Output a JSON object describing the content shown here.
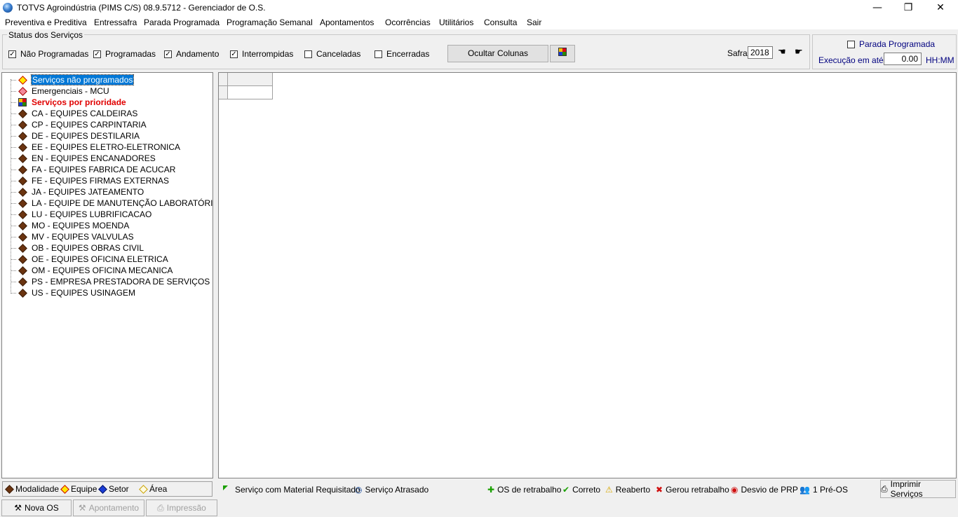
{
  "window": {
    "title": "TOTVS Agroindústria (PIMS C/S) 08.9.5712 - Gerenciador de O.S.",
    "minimize": "—",
    "restore": "❐",
    "close": "✕"
  },
  "menu": [
    "Preventiva e Preditiva",
    "Entressafra",
    "Parada Programada",
    "Programação Semanal",
    "Apontamentos",
    "Ocorrências",
    "Utilitários",
    "Consulta",
    "Sair"
  ],
  "status_group": {
    "legend": "Status dos Serviços",
    "checkboxes": [
      {
        "label": "Não Programadas",
        "checked": true
      },
      {
        "label": "Programadas",
        "checked": true
      },
      {
        "label": "Andamento",
        "checked": true
      },
      {
        "label": "Interrompidas",
        "checked": true
      },
      {
        "label": "Canceladas",
        "checked": false
      },
      {
        "label": "Encerradas",
        "checked": false
      }
    ],
    "hide_columns_button": "Ocultar Colunas",
    "safra_label": "Safra",
    "safra_value": "2018"
  },
  "parada": {
    "checkbox_label": "Parada Programada",
    "checked": false,
    "exec_label": "Execução em até:",
    "exec_value": "0.00",
    "unit": "HH:MM"
  },
  "tree": [
    {
      "label": "Serviços não programados",
      "icon": "diamond-yellow-icon",
      "selected": true
    },
    {
      "label": "Emergenciais - MCU",
      "icon": "diamond-pink-icon"
    },
    {
      "label": "Serviços por prioridade",
      "icon": "color-grid-icon",
      "bold_red": true
    },
    {
      "label": "CA - EQUIPES CALDEIRAS",
      "icon": "diamond-brown-icon"
    },
    {
      "label": "CP - EQUIPES CARPINTARIA",
      "icon": "diamond-brown-icon"
    },
    {
      "label": "DE - EQUIPES DESTILARIA",
      "icon": "diamond-brown-icon"
    },
    {
      "label": "EE - EQUIPES ELETRO-ELETRONICA",
      "icon": "diamond-brown-icon"
    },
    {
      "label": "EN - EQUIPES ENCANADORES",
      "icon": "diamond-brown-icon"
    },
    {
      "label": "FA - EQUIPES FABRICA DE ACUCAR",
      "icon": "diamond-brown-icon"
    },
    {
      "label": "FE - EQUIPES FIRMAS EXTERNAS",
      "icon": "diamond-brown-icon"
    },
    {
      "label": "JA - EQUIPES JATEAMENTO",
      "icon": "diamond-brown-icon"
    },
    {
      "label": "LA - EQUIPE DE MANUTENÇÃO LABORATÓRIOS",
      "icon": "diamond-brown-icon"
    },
    {
      "label": "LU - EQUIPES LUBRIFICACAO",
      "icon": "diamond-brown-icon"
    },
    {
      "label": "MO - EQUIPES MOENDA",
      "icon": "diamond-brown-icon"
    },
    {
      "label": "MV - EQUIPES VALVULAS",
      "icon": "diamond-brown-icon"
    },
    {
      "label": "OB - EQUIPES OBRAS CIVIL",
      "icon": "diamond-brown-icon"
    },
    {
      "label": "OE - EQUIPES OFICINA ELETRICA",
      "icon": "diamond-brown-icon"
    },
    {
      "label": "OM - EQUIPES OFICINA MECANICA",
      "icon": "diamond-brown-icon"
    },
    {
      "label": "PS - EMPRESA PRESTADORA DE SERVIÇOS",
      "icon": "diamond-brown-icon"
    },
    {
      "label": "US - EQUIPES USINAGEM",
      "icon": "diamond-brown-icon"
    }
  ],
  "tabs": [
    "Modalidade",
    "Equipe",
    "Setor",
    "Área"
  ],
  "legend": {
    "material": "Serviço com Material Requisitado",
    "atrasado": "Serviço Atrasado",
    "retrabalho": "OS de retrabalho",
    "correto": "Correto",
    "reaberto": "Reaberto",
    "gerou": "Gerou retrabalho",
    "desvio": "Desvio de PRP",
    "preos": "1 Pré-OS"
  },
  "buttons": {
    "nova_os": "Nova OS",
    "apontamento": "Apontamento",
    "impressao": "Impressão",
    "imprimir": "Imprimir Serviços"
  },
  "colors": {
    "selection": "#0078d7",
    "priority_text": "#e00000",
    "label_blue": "#00007f"
  }
}
